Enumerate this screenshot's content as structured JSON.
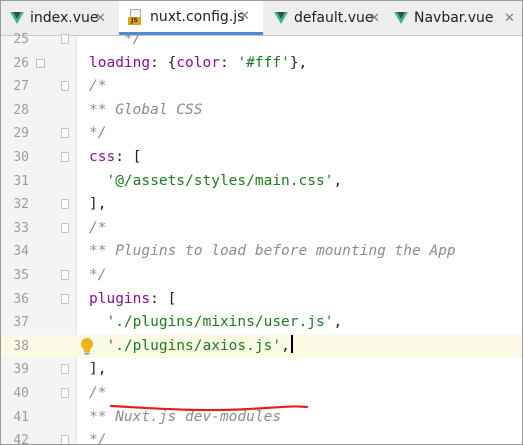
{
  "tabs": [
    {
      "label": "index.vue",
      "icon": "vue-icon",
      "active": false
    },
    {
      "label": "nuxt.config.js",
      "icon": "js-file-icon",
      "active": true
    },
    {
      "label": "default.vue",
      "icon": "vue-icon",
      "active": false
    },
    {
      "label": "Navbar.vue",
      "icon": "vue-icon",
      "active": false
    }
  ],
  "close_glyph": "✕",
  "js_badge": "JS",
  "colors": {
    "vue_green": "#41b883",
    "vue_dark": "#35495e",
    "active_tab_underline": "#4a8ad6",
    "property": "#871094",
    "string": "#1e7a1e",
    "comment": "#8c8c8c",
    "current_line": "#fbfbe5",
    "red_underline": "#e0201c"
  },
  "editor": {
    "current_line": 38,
    "lines": [
      {
        "num": "25",
        "parts": [
          {
            "t": "    */",
            "c": "c"
          }
        ]
      },
      {
        "num": "26",
        "parts": [
          {
            "t": "loading",
            "c": "k"
          },
          {
            "t": ": {",
            "c": ""
          },
          {
            "t": "color",
            "c": "k"
          },
          {
            "t": ": ",
            "c": ""
          },
          {
            "t": "'#fff'",
            "c": "s"
          },
          {
            "t": "},",
            "c": ""
          }
        ]
      },
      {
        "num": "27",
        "parts": [
          {
            "t": "/*",
            "c": "c"
          }
        ]
      },
      {
        "num": "28",
        "parts": [
          {
            "t": "** Global CSS",
            "c": "c"
          }
        ]
      },
      {
        "num": "29",
        "parts": [
          {
            "t": "*/",
            "c": "c"
          }
        ]
      },
      {
        "num": "30",
        "parts": [
          {
            "t": "css",
            "c": "k"
          },
          {
            "t": ": [",
            "c": ""
          }
        ]
      },
      {
        "num": "31",
        "parts": [
          {
            "t": "  '@/assets/styles/main.css'",
            "c": "s"
          },
          {
            "t": ",",
            "c": ""
          }
        ]
      },
      {
        "num": "32",
        "parts": [
          {
            "t": "],",
            "c": ""
          }
        ]
      },
      {
        "num": "33",
        "parts": [
          {
            "t": "/*",
            "c": "c"
          }
        ]
      },
      {
        "num": "34",
        "parts": [
          {
            "t": "** Plugins to load before mounting the App",
            "c": "c"
          }
        ]
      },
      {
        "num": "35",
        "parts": [
          {
            "t": "*/",
            "c": "c"
          }
        ]
      },
      {
        "num": "36",
        "parts": [
          {
            "t": "plugins",
            "c": "k"
          },
          {
            "t": ": [",
            "c": ""
          }
        ]
      },
      {
        "num": "37",
        "parts": [
          {
            "t": "  './plugins/mixins/user.js'",
            "c": "s"
          },
          {
            "t": ",",
            "c": ""
          }
        ]
      },
      {
        "num": "38",
        "parts": [
          {
            "t": "  './plugins/axios.js'",
            "c": "s"
          },
          {
            "t": ",",
            "c": ""
          }
        ]
      },
      {
        "num": "39",
        "parts": [
          {
            "t": "],",
            "c": ""
          }
        ]
      },
      {
        "num": "40",
        "parts": [
          {
            "t": "/*",
            "c": "c"
          }
        ]
      },
      {
        "num": "41",
        "parts": [
          {
            "t": "** Nuxt.js dev-modules",
            "c": "c"
          }
        ]
      },
      {
        "num": "42",
        "parts": [
          {
            "t": "*/",
            "c": "c"
          }
        ]
      }
    ]
  }
}
